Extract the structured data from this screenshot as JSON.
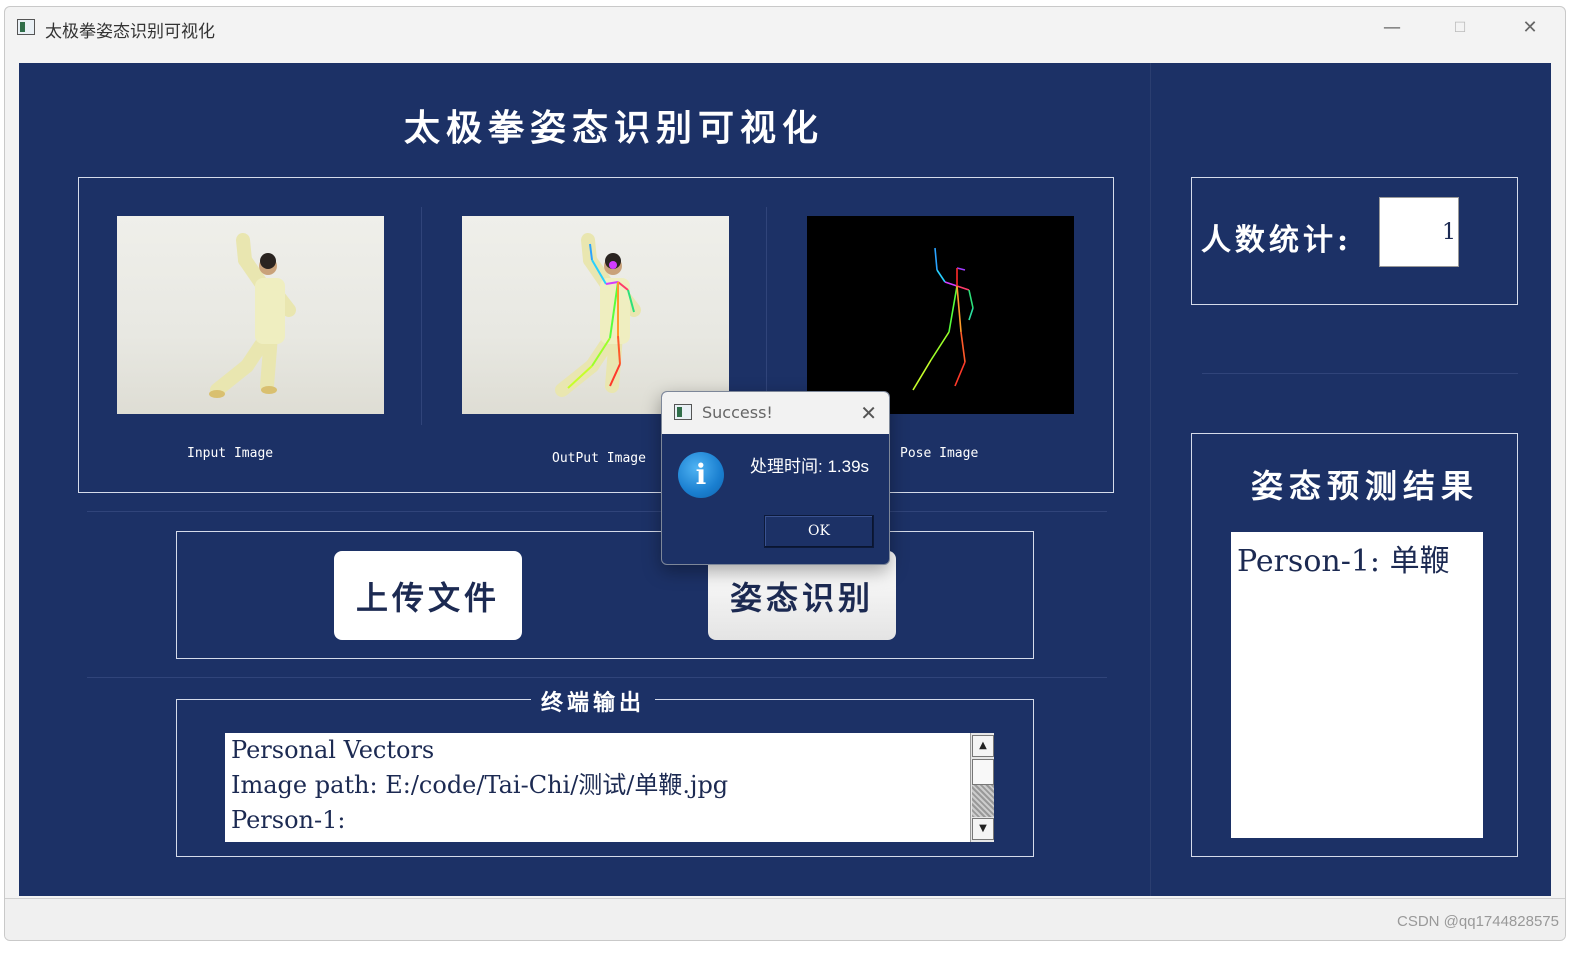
{
  "window": {
    "title": "太极拳姿态识别可视化",
    "minimize_glyph": "—",
    "maximize_glyph": "☐",
    "close_glyph": "✕"
  },
  "main": {
    "heading": "太极拳姿态识别可视化"
  },
  "images": {
    "input_caption": "Input Image",
    "output_caption": "OutPut Image",
    "pose_caption": "Pose Image"
  },
  "buttons": {
    "upload_label": "上传文件",
    "recognize_label": "姿态识别"
  },
  "terminal": {
    "group_label": "终端输出",
    "lines": [
      "Personal Vectors",
      "Image path: E:/code/Tai-Chi/测试/单鞭.jpg",
      "Person-1:"
    ],
    "scroll_up_glyph": "▲",
    "scroll_down_glyph": "▼"
  },
  "count": {
    "label": "人数统计:",
    "value": "1"
  },
  "results": {
    "title": "姿态预测结果",
    "text": "Person-1: 单鞭"
  },
  "dialog": {
    "title": "Success!",
    "close_glyph": "✕",
    "icon_glyph": "i",
    "message": "处理时间: 1.39s",
    "ok_label": "OK"
  },
  "watermark": "CSDN @qq1744828575"
}
